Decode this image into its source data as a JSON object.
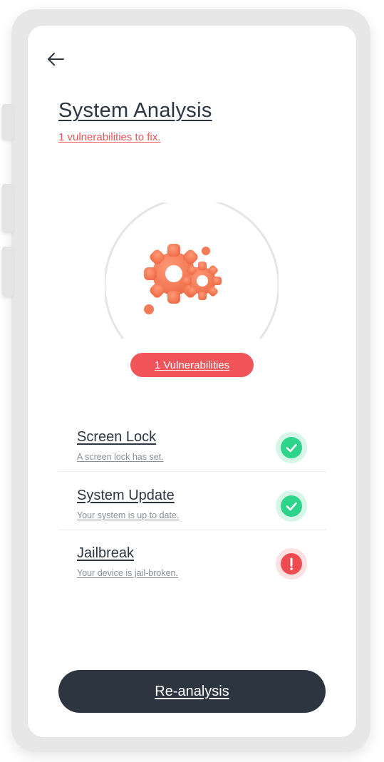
{
  "header": {
    "back_icon": "arrow-left-icon",
    "title": "System Analysis",
    "subtitle": "1 vulnerabilities to fix."
  },
  "gauge": {
    "illustration_icon": "gears-icon",
    "badge_label": "1 Vulnerabilities"
  },
  "checks": [
    {
      "name": "Screen Lock",
      "description": "A screen lock has set.",
      "status": "ok",
      "status_icon": "check-icon"
    },
    {
      "name": "System Update",
      "description": "Your system is up to date.",
      "status": "ok",
      "status_icon": "check-icon"
    },
    {
      "name": "Jailbreak",
      "description": "Your device is jail-broken.",
      "status": "warning",
      "status_icon": "exclamation-icon"
    }
  ],
  "actions": {
    "reanalysis_label": "Re-analysis"
  },
  "colors": {
    "primary_dark": "#2c3540",
    "alert_red": "#f1555a",
    "success_green": "#2dd48a",
    "gear_orange": "#f47b58"
  }
}
